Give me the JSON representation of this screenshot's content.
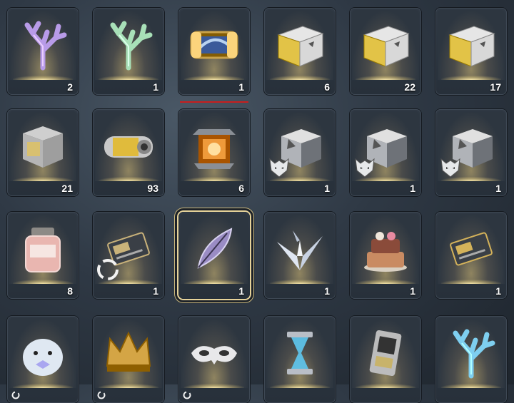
{
  "inventory": {
    "rows": [
      [
        {
          "name": "prismatic-coral",
          "qty": "2",
          "icon": "coral-icon",
          "color": "#b89be8"
        },
        {
          "name": "iridescent-coral",
          "qty": "1",
          "icon": "coral-icon",
          "color": "#a8e0b8"
        },
        {
          "name": "supply-crate",
          "qty": "1",
          "icon": "capsule-box-icon",
          "color": "#c9a24a"
        },
        {
          "name": "gold-crate-a",
          "qty": "6",
          "icon": "gold-box-icon",
          "color": "#e2c347"
        },
        {
          "name": "gold-crate-b",
          "qty": "22",
          "icon": "gold-box-icon",
          "color": "#e2c347"
        },
        {
          "name": "gold-crate-c",
          "qty": "17",
          "icon": "gold-box-icon",
          "color": "#e2c347"
        }
      ],
      [
        {
          "name": "cube-cache",
          "qty": "21",
          "icon": "cube-box-icon",
          "color": "#d8c070"
        },
        {
          "name": "fuel-canister",
          "qty": "93",
          "icon": "canister-icon",
          "color": "#e0bb3c"
        },
        {
          "name": "lantern",
          "qty": "6",
          "icon": "lantern-icon",
          "color": "#ef9a3a"
        },
        {
          "name": "wolf-crate-a",
          "qty": "1",
          "icon": "silver-box-icon",
          "color": "#c7cbd0",
          "badge": "wolf-badge-icon"
        },
        {
          "name": "wolf-crate-b",
          "qty": "1",
          "icon": "silver-box-icon",
          "color": "#c7cbd0",
          "badge": "wolf-badge-icon"
        },
        {
          "name": "wolf-crate-c",
          "qty": "1",
          "icon": "silver-box-icon",
          "color": "#c7cbd0",
          "badge": "wolf-badge-icon"
        }
      ],
      [
        {
          "name": "powder-jar",
          "qty": "8",
          "icon": "jar-icon",
          "color": "#e9b6b0"
        },
        {
          "name": "voucher-card",
          "qty": "1",
          "icon": "card-icon",
          "color": "#c9b27a",
          "badge": "recycle-badge-icon"
        },
        {
          "name": "crystal-feather",
          "qty": "1",
          "icon": "feather-icon",
          "color": "#9a8cc4",
          "selected": true
        },
        {
          "name": "paper-crane",
          "qty": "1",
          "icon": "crane-icon",
          "color": "#dfe6f2"
        },
        {
          "name": "celebration-cake",
          "qty": "1",
          "icon": "cake-icon",
          "color": "#c98b62"
        },
        {
          "name": "gilded-card",
          "qty": "1",
          "icon": "card-icon",
          "color": "#d4b25a"
        }
      ],
      [
        {
          "name": "seal-plush",
          "qty": "",
          "icon": "seal-icon",
          "color": "#dfe8f2",
          "mini": "cycle-icon"
        },
        {
          "name": "golden-crown",
          "qty": "",
          "icon": "crown-icon",
          "color": "#d4a545",
          "mini": "cycle-icon"
        },
        {
          "name": "masquerade-mask",
          "qty": "",
          "icon": "mask-icon",
          "color": "#e8e8ea",
          "mini": "cycle-icon"
        },
        {
          "name": "hourglass",
          "qty": "",
          "icon": "hourglass-icon",
          "color": "#5ec8f0"
        },
        {
          "name": "data-device",
          "qty": "",
          "icon": "device-icon",
          "color": "#c8b36a"
        },
        {
          "name": "frost-coral",
          "qty": "",
          "icon": "coral-icon",
          "color": "#7ecff0"
        }
      ]
    ]
  },
  "colors": {
    "selection": "#e7d39a",
    "underline": "#c81e1e"
  }
}
